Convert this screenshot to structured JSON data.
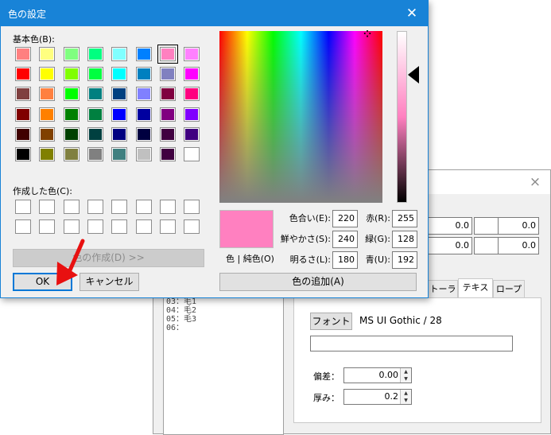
{
  "colors": {
    "accent": "#1883d7",
    "dialog_bg": "#f0f0f0",
    "current_color": "#ff80c0",
    "annotation": "#e81010"
  },
  "dialog": {
    "title": "色の設定",
    "basic_colors_label": "基本色(B):",
    "basic_colors": [
      [
        "#ff8080",
        "#ffff80",
        "#80ff80",
        "#00ff80",
        "#80ffff",
        "#0080ff",
        "#ff80c0",
        "#ff80ff"
      ],
      [
        "#ff0000",
        "#ffff00",
        "#80ff00",
        "#00ff40",
        "#00ffff",
        "#0080c0",
        "#8080c0",
        "#ff00ff"
      ],
      [
        "#804040",
        "#ff8040",
        "#00ff00",
        "#008080",
        "#004080",
        "#8080ff",
        "#800040",
        "#ff0080"
      ],
      [
        "#800000",
        "#ff8000",
        "#008000",
        "#008040",
        "#0000ff",
        "#0000a0",
        "#800080",
        "#8000ff"
      ],
      [
        "#400000",
        "#804000",
        "#004000",
        "#004040",
        "#000080",
        "#000040",
        "#400040",
        "#400080"
      ],
      [
        "#000000",
        "#808000",
        "#808040",
        "#808080",
        "#408080",
        "#c0c0c0",
        "#400040",
        "#ffffff"
      ]
    ],
    "selected_swatch_index": 6,
    "custom_colors_label": "作成した色(C):",
    "define_custom_label": "色の作成(D) >>",
    "ok_label": "OK",
    "cancel_label": "キャンセル",
    "solid_color_label": "色 | 純色(O)",
    "hue_label": "色合い(E):",
    "hue_value": "220",
    "sat_label": "鮮やかさ(S):",
    "sat_value": "240",
    "lum_label": "明るさ(L):",
    "lum_value": "180",
    "red_label": "赤(R):",
    "red_value": "255",
    "green_label": "緑(G):",
    "green_value": "128",
    "blue_label": "青(U):",
    "blue_value": "192",
    "add_custom_label": "色の追加(A)"
  },
  "background_window": {
    "close_symbol": "×",
    "number_fields": [
      "0.0",
      "0.0",
      "0.0",
      "0.0",
      "0.0",
      "0.0"
    ],
    "tabs": [
      "トーラス",
      "テキスト",
      "ロープ"
    ],
    "active_tab": "テキスト",
    "list_lines": [
      "03：毛1",
      "04：毛2",
      "05：毛3",
      "06："
    ],
    "font_button_label": "フォント",
    "font_name": "MS UI Gothic / 28",
    "text_input_value": "",
    "offset_label": "偏差：",
    "offset_value": "0.00",
    "thickness_label": "厚み：",
    "thickness_value": "0.2"
  }
}
